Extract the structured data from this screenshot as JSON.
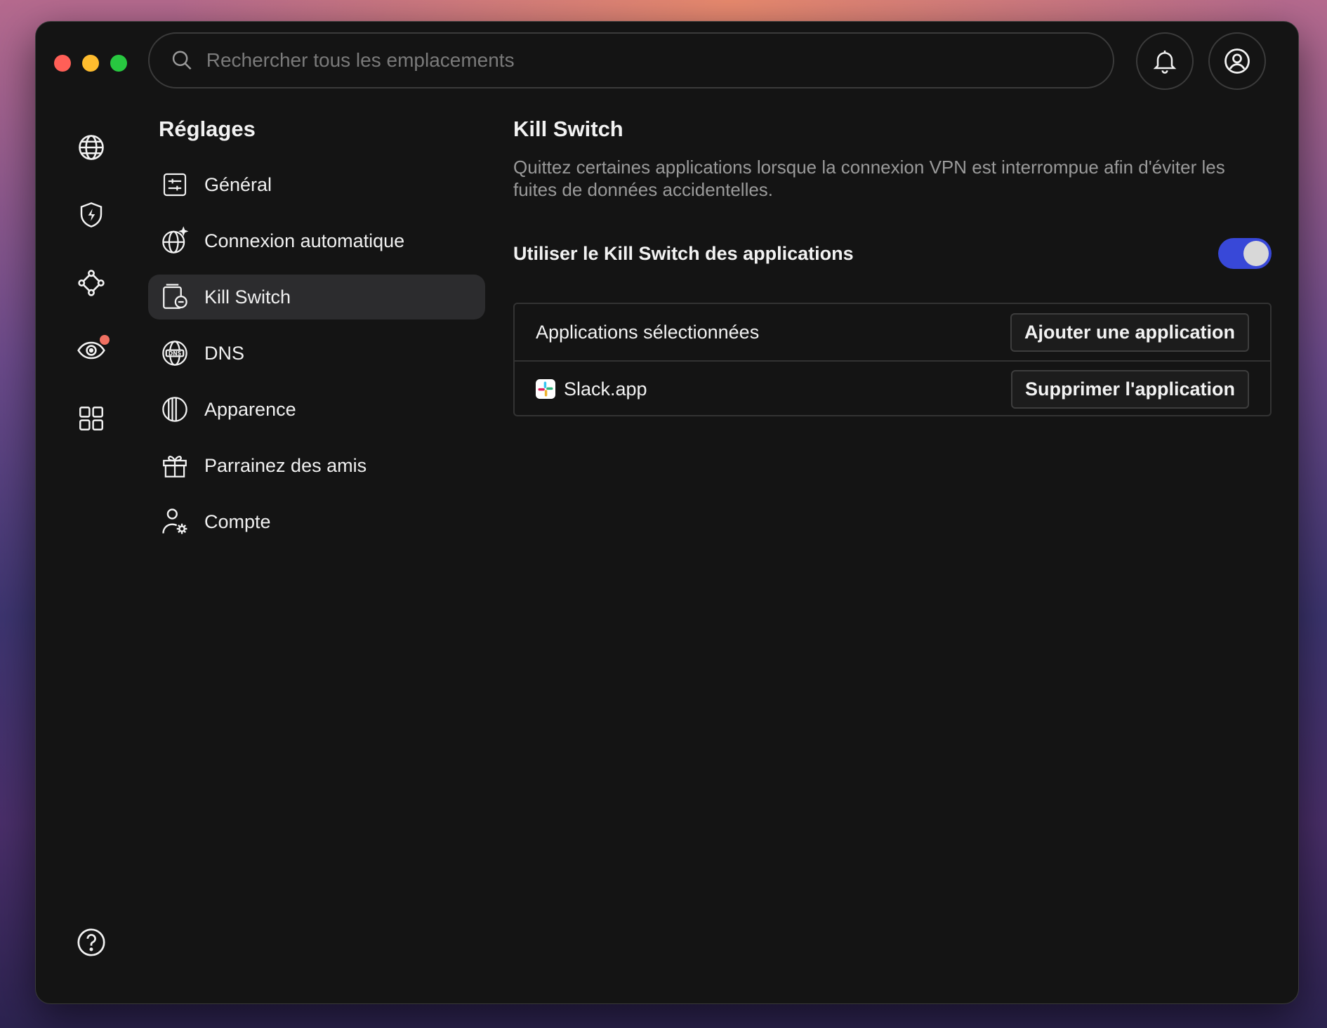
{
  "search": {
    "placeholder": "Rechercher tous les emplacements"
  },
  "sidebar": {
    "title": "Réglages",
    "items": [
      {
        "label": "Général",
        "icon": "sliders-icon"
      },
      {
        "label": "Connexion automatique",
        "icon": "globe-sparkle-icon"
      },
      {
        "label": "Kill Switch",
        "icon": "kill-switch-icon",
        "active": true
      },
      {
        "label": "DNS",
        "icon": "dns-globe-icon"
      },
      {
        "label": "Apparence",
        "icon": "appearance-icon"
      },
      {
        "label": "Parrainez des amis",
        "icon": "gift-icon"
      },
      {
        "label": "Compte",
        "icon": "account-settings-icon"
      }
    ]
  },
  "rail": [
    "globe-icon",
    "shield-bolt-icon",
    "meshnet-icon",
    "threat-radar-icon",
    "apps-grid-icon"
  ],
  "main": {
    "title": "Kill Switch",
    "description": "Quittez certaines applications lorsque la connexion VPN est interrompue afin d'éviter les fuites de données accidentelles.",
    "toggle_label": "Utiliser le Kill Switch des applications",
    "toggle_on": true,
    "apps_header": "Applications sélectionnées",
    "add_button": "Ajouter une application",
    "apps": [
      {
        "name": "Slack.app",
        "remove_button": "Supprimer l'application"
      }
    ]
  },
  "colors": {
    "accent": "#3848d8",
    "badge": "#f07061"
  }
}
